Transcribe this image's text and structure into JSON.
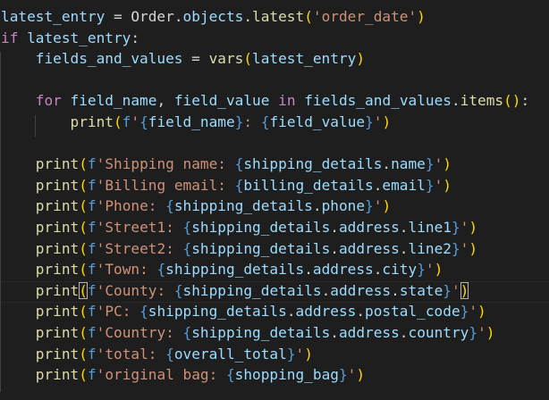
{
  "editor": {
    "language": "python",
    "theme": "dark",
    "colors": {
      "background": "#1e1e1e",
      "default": "#d4d4d4",
      "variable": "#9cdcfe",
      "function": "#dcdcaa",
      "string": "#ce9178",
      "keyword": "#569cd6",
      "control": "#c586c0",
      "bracket_level1": "#ffd700",
      "bracket_level2": "#da70d6",
      "bracket_level3": "#179fff"
    },
    "lines": [
      {
        "indent": "",
        "tokens": [
          {
            "t": "latest_entry",
            "c": "v"
          },
          {
            "t": " = ",
            "c": "w"
          },
          {
            "t": "Order",
            "c": "w"
          },
          {
            "t": ".",
            "c": "w"
          },
          {
            "t": "objects",
            "c": "v"
          },
          {
            "t": ".",
            "c": "w"
          },
          {
            "t": "latest",
            "c": "f"
          },
          {
            "t": "(",
            "c": "b1"
          },
          {
            "t": "'order_date'",
            "c": "s"
          },
          {
            "t": ")",
            "c": "b1"
          }
        ]
      },
      {
        "indent": "",
        "tokens": [
          {
            "t": "if",
            "c": "c"
          },
          {
            "t": " ",
            "c": "w"
          },
          {
            "t": "latest_entry",
            "c": "v"
          },
          {
            "t": ":",
            "c": "w"
          }
        ]
      },
      {
        "indent": "    ",
        "tokens": [
          {
            "t": "fields_and_values",
            "c": "v"
          },
          {
            "t": " = ",
            "c": "w"
          },
          {
            "t": "vars",
            "c": "f"
          },
          {
            "t": "(",
            "c": "b1"
          },
          {
            "t": "latest_entry",
            "c": "v"
          },
          {
            "t": ")",
            "c": "b1"
          }
        ]
      },
      {
        "indent": "",
        "tokens": []
      },
      {
        "indent": "    ",
        "tokens": [
          {
            "t": "for",
            "c": "c"
          },
          {
            "t": " ",
            "c": "w"
          },
          {
            "t": "field_name",
            "c": "v"
          },
          {
            "t": ", ",
            "c": "w"
          },
          {
            "t": "field_value",
            "c": "v"
          },
          {
            "t": " ",
            "c": "w"
          },
          {
            "t": "in",
            "c": "c"
          },
          {
            "t": " ",
            "c": "w"
          },
          {
            "t": "fields_and_values",
            "c": "v"
          },
          {
            "t": ".",
            "c": "w"
          },
          {
            "t": "items",
            "c": "f"
          },
          {
            "t": "()",
            "c": "b1"
          },
          {
            "t": ":",
            "c": "w"
          }
        ]
      },
      {
        "indent": "        ",
        "tokens": [
          {
            "t": "print",
            "c": "f"
          },
          {
            "t": "(",
            "c": "b1"
          },
          {
            "t": "f",
            "c": "k"
          },
          {
            "t": "'",
            "c": "s"
          },
          {
            "t": "{",
            "c": "k"
          },
          {
            "t": "field_name",
            "c": "v"
          },
          {
            "t": "}",
            "c": "k"
          },
          {
            "t": ": ",
            "c": "s"
          },
          {
            "t": "{",
            "c": "k"
          },
          {
            "t": "field_value",
            "c": "v"
          },
          {
            "t": "}",
            "c": "k"
          },
          {
            "t": "'",
            "c": "s"
          },
          {
            "t": ")",
            "c": "b1"
          }
        ]
      },
      {
        "indent": "",
        "tokens": []
      },
      {
        "indent": "    ",
        "tokens": [
          {
            "t": "print",
            "c": "f"
          },
          {
            "t": "(",
            "c": "b1"
          },
          {
            "t": "f",
            "c": "k"
          },
          {
            "t": "'Shipping name: ",
            "c": "s"
          },
          {
            "t": "{",
            "c": "k"
          },
          {
            "t": "shipping_details",
            "c": "v"
          },
          {
            "t": ".",
            "c": "w"
          },
          {
            "t": "name",
            "c": "v"
          },
          {
            "t": "}",
            "c": "k"
          },
          {
            "t": "'",
            "c": "s"
          },
          {
            "t": ")",
            "c": "b1"
          }
        ]
      },
      {
        "indent": "    ",
        "tokens": [
          {
            "t": "print",
            "c": "f"
          },
          {
            "t": "(",
            "c": "b1"
          },
          {
            "t": "f",
            "c": "k"
          },
          {
            "t": "'Billing email: ",
            "c": "s"
          },
          {
            "t": "{",
            "c": "k"
          },
          {
            "t": "billing_details",
            "c": "v"
          },
          {
            "t": ".",
            "c": "w"
          },
          {
            "t": "email",
            "c": "v"
          },
          {
            "t": "}",
            "c": "k"
          },
          {
            "t": "'",
            "c": "s"
          },
          {
            "t": ")",
            "c": "b1"
          }
        ]
      },
      {
        "indent": "    ",
        "tokens": [
          {
            "t": "print",
            "c": "f"
          },
          {
            "t": "(",
            "c": "b1"
          },
          {
            "t": "f",
            "c": "k"
          },
          {
            "t": "'Phone: ",
            "c": "s"
          },
          {
            "t": "{",
            "c": "k"
          },
          {
            "t": "shipping_details",
            "c": "v"
          },
          {
            "t": ".",
            "c": "w"
          },
          {
            "t": "phone",
            "c": "v"
          },
          {
            "t": "}",
            "c": "k"
          },
          {
            "t": "'",
            "c": "s"
          },
          {
            "t": ")",
            "c": "b1"
          }
        ]
      },
      {
        "indent": "    ",
        "tokens": [
          {
            "t": "print",
            "c": "f"
          },
          {
            "t": "(",
            "c": "b1"
          },
          {
            "t": "f",
            "c": "k"
          },
          {
            "t": "'Street1: ",
            "c": "s"
          },
          {
            "t": "{",
            "c": "k"
          },
          {
            "t": "shipping_details",
            "c": "v"
          },
          {
            "t": ".",
            "c": "w"
          },
          {
            "t": "address",
            "c": "v"
          },
          {
            "t": ".",
            "c": "w"
          },
          {
            "t": "line1",
            "c": "v"
          },
          {
            "t": "}",
            "c": "k"
          },
          {
            "t": "'",
            "c": "s"
          },
          {
            "t": ")",
            "c": "b1"
          }
        ]
      },
      {
        "indent": "    ",
        "tokens": [
          {
            "t": "print",
            "c": "f"
          },
          {
            "t": "(",
            "c": "b1"
          },
          {
            "t": "f",
            "c": "k"
          },
          {
            "t": "'Street2: ",
            "c": "s"
          },
          {
            "t": "{",
            "c": "k"
          },
          {
            "t": "shipping_details",
            "c": "v"
          },
          {
            "t": ".",
            "c": "w"
          },
          {
            "t": "address",
            "c": "v"
          },
          {
            "t": ".",
            "c": "w"
          },
          {
            "t": "line2",
            "c": "v"
          },
          {
            "t": "}",
            "c": "k"
          },
          {
            "t": "'",
            "c": "s"
          },
          {
            "t": ")",
            "c": "b1"
          }
        ]
      },
      {
        "indent": "    ",
        "tokens": [
          {
            "t": "print",
            "c": "f"
          },
          {
            "t": "(",
            "c": "b1"
          },
          {
            "t": "f",
            "c": "k"
          },
          {
            "t": "'Town: ",
            "c": "s"
          },
          {
            "t": "{",
            "c": "k"
          },
          {
            "t": "shipping_details",
            "c": "v"
          },
          {
            "t": ".",
            "c": "w"
          },
          {
            "t": "address",
            "c": "v"
          },
          {
            "t": ".",
            "c": "w"
          },
          {
            "t": "city",
            "c": "v"
          },
          {
            "t": "}",
            "c": "k"
          },
          {
            "t": "'",
            "c": "s"
          },
          {
            "t": ")",
            "c": "b1"
          }
        ]
      },
      {
        "indent": "    ",
        "cursor": true,
        "tokens": [
          {
            "t": "print",
            "c": "f"
          },
          {
            "t": "(",
            "c": "b1",
            "m": true
          },
          {
            "t": "f",
            "c": "k"
          },
          {
            "t": "'County: ",
            "c": "s"
          },
          {
            "t": "{",
            "c": "k"
          },
          {
            "t": "shipping_details",
            "c": "v"
          },
          {
            "t": ".",
            "c": "w"
          },
          {
            "t": "address",
            "c": "v"
          },
          {
            "t": ".",
            "c": "w"
          },
          {
            "t": "state",
            "c": "v"
          },
          {
            "t": "}",
            "c": "k"
          },
          {
            "t": "'",
            "c": "s"
          },
          {
            "t": ")",
            "c": "b1",
            "m": true
          }
        ]
      },
      {
        "indent": "    ",
        "tokens": [
          {
            "t": "print",
            "c": "f"
          },
          {
            "t": "(",
            "c": "b1"
          },
          {
            "t": "f",
            "c": "k"
          },
          {
            "t": "'PC: ",
            "c": "s"
          },
          {
            "t": "{",
            "c": "k"
          },
          {
            "t": "shipping_details",
            "c": "v"
          },
          {
            "t": ".",
            "c": "w"
          },
          {
            "t": "address",
            "c": "v"
          },
          {
            "t": ".",
            "c": "w"
          },
          {
            "t": "postal_code",
            "c": "v"
          },
          {
            "t": "}",
            "c": "k"
          },
          {
            "t": "'",
            "c": "s"
          },
          {
            "t": ")",
            "c": "b1"
          }
        ]
      },
      {
        "indent": "    ",
        "tokens": [
          {
            "t": "print",
            "c": "f"
          },
          {
            "t": "(",
            "c": "b1"
          },
          {
            "t": "f",
            "c": "k"
          },
          {
            "t": "'Country: ",
            "c": "s"
          },
          {
            "t": "{",
            "c": "k"
          },
          {
            "t": "shipping_details",
            "c": "v"
          },
          {
            "t": ".",
            "c": "w"
          },
          {
            "t": "address",
            "c": "v"
          },
          {
            "t": ".",
            "c": "w"
          },
          {
            "t": "country",
            "c": "v"
          },
          {
            "t": "}",
            "c": "k"
          },
          {
            "t": "'",
            "c": "s"
          },
          {
            "t": ")",
            "c": "b1"
          }
        ]
      },
      {
        "indent": "    ",
        "tokens": [
          {
            "t": "print",
            "c": "f"
          },
          {
            "t": "(",
            "c": "b1"
          },
          {
            "t": "f",
            "c": "k"
          },
          {
            "t": "'total: ",
            "c": "s"
          },
          {
            "t": "{",
            "c": "k"
          },
          {
            "t": "overall_total",
            "c": "v"
          },
          {
            "t": "}",
            "c": "k"
          },
          {
            "t": "'",
            "c": "s"
          },
          {
            "t": ")",
            "c": "b1"
          }
        ]
      },
      {
        "indent": "    ",
        "tokens": [
          {
            "t": "print",
            "c": "f"
          },
          {
            "t": "(",
            "c": "b1"
          },
          {
            "t": "f",
            "c": "k"
          },
          {
            "t": "'original bag: ",
            "c": "s"
          },
          {
            "t": "{",
            "c": "k"
          },
          {
            "t": "shopping_bag",
            "c": "v"
          },
          {
            "t": "}",
            "c": "k"
          },
          {
            "t": "'",
            "c": "s"
          },
          {
            "t": ")",
            "c": "b1"
          }
        ]
      }
    ]
  }
}
